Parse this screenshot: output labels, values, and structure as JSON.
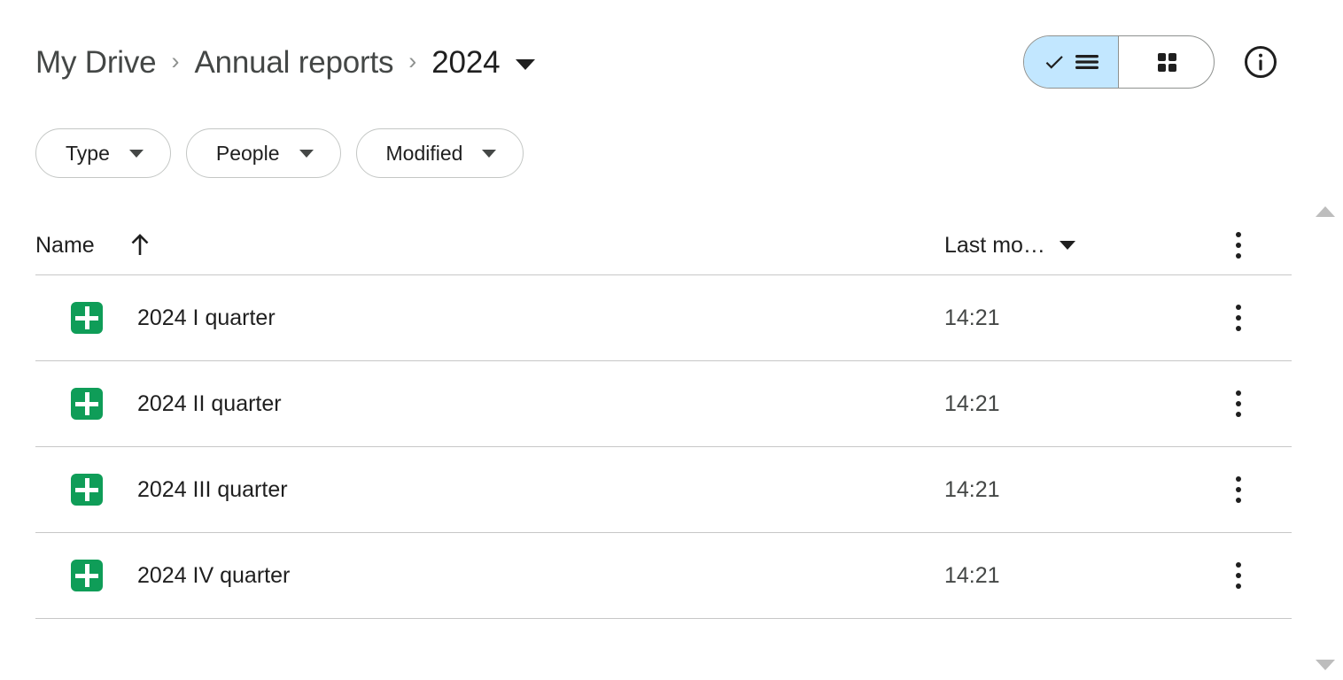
{
  "breadcrumb": {
    "items": [
      {
        "label": "My Drive"
      },
      {
        "label": "Annual reports"
      },
      {
        "label": "2024"
      }
    ],
    "separator": "›"
  },
  "view_toggle": {
    "list_icon": "check-list-icon",
    "grid_icon": "grid-view-icon",
    "selected": "list"
  },
  "info_button": {
    "icon": "info-circle-icon"
  },
  "filters": [
    {
      "label": "Type",
      "name": "type"
    },
    {
      "label": "People",
      "name": "people"
    },
    {
      "label": "Modified",
      "name": "modified"
    }
  ],
  "table": {
    "columns": {
      "name": "Name",
      "name_sort_icon": "sort-ascending-arrow-icon",
      "modified": "Last mo…",
      "more_icon": "more-options-icon"
    },
    "rows": [
      {
        "name": "2024 I quarter",
        "icon": "google-sheets-icon",
        "icon_color": "#0f9d58",
        "modified": "14:21"
      },
      {
        "name": "2024 II quarter",
        "icon": "google-sheets-icon",
        "icon_color": "#0f9d58",
        "modified": "14:21"
      },
      {
        "name": "2024 III quarter",
        "icon": "google-sheets-icon",
        "icon_color": "#0f9d58",
        "modified": "14:21"
      },
      {
        "name": "2024 IV quarter",
        "icon": "google-sheets-icon",
        "icon_color": "#0f9d58",
        "modified": "14:21"
      }
    ]
  },
  "scrollbar": {
    "up_icon": "scroll-up-arrow-icon",
    "down_icon": "scroll-down-arrow-icon"
  },
  "colors": {
    "selected_segment": "#c2e7ff",
    "sheets_green": "#0f9d58",
    "divider": "#c7c7c7",
    "text_primary": "#1f1f1f",
    "text_secondary": "#444746"
  }
}
